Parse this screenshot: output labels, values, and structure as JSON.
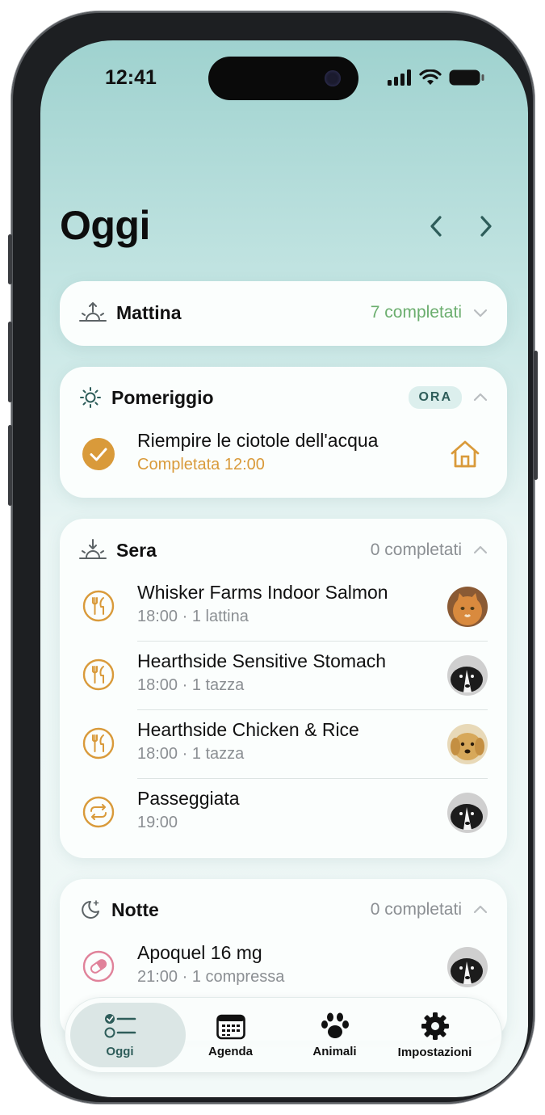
{
  "status_bar": {
    "time": "12:41"
  },
  "header": {
    "title": "Oggi",
    "prev_icon": "chevron-left-icon",
    "next_icon": "chevron-right-icon"
  },
  "colors": {
    "accent": "#D99A3A",
    "teal": "#2E5D5A",
    "completed_green": "#6BAE6E",
    "pill_pink": "#E0829A"
  },
  "sections": {
    "mattina": {
      "title": "Mattina",
      "count": "7 completati",
      "icon": "sunrise-icon"
    },
    "pomeriggio": {
      "title": "Pomeriggio",
      "badge": "ORA",
      "icon": "sun-icon",
      "items": [
        {
          "title": "Riempire le ciotole dell'acqua",
          "subtitle": "Completata 12:00",
          "icon": "check-circle-icon",
          "trailing_icon": "house-icon"
        }
      ]
    },
    "sera": {
      "title": "Sera",
      "count": "0 completati",
      "icon": "sunset-icon",
      "items": [
        {
          "title": "Whisker Farms Indoor Salmon",
          "subtitle": "18:00 · 1 lattina",
          "icon": "fork-knife-icon",
          "avatar": "orange-cat"
        },
        {
          "title": "Hearthside Sensitive Stomach",
          "subtitle": "18:00 · 1 tazza",
          "icon": "fork-knife-icon",
          "avatar": "border-collie"
        },
        {
          "title": "Hearthside Chicken & Rice",
          "subtitle": "18:00 · 1 tazza",
          "icon": "fork-knife-icon",
          "avatar": "golden-retriever"
        },
        {
          "title": "Passeggiata",
          "subtitle": "19:00",
          "icon": "repeat-icon",
          "avatar": "border-collie"
        }
      ]
    },
    "notte": {
      "title": "Notte",
      "count": "0 completati",
      "icon": "moon-stars-icon",
      "items": [
        {
          "title": "Apoquel 16 mg",
          "subtitle": "21:00 · 1 compressa",
          "icon": "pill-icon",
          "avatar": "border-collie"
        }
      ]
    }
  },
  "tabbar": {
    "tabs": [
      {
        "label": "Oggi",
        "icon": "checklist-icon",
        "active": true
      },
      {
        "label": "Agenda",
        "icon": "calendar-icon",
        "active": false
      },
      {
        "label": "Animali",
        "icon": "paw-icon",
        "active": false
      },
      {
        "label": "Impostazioni",
        "icon": "gear-icon",
        "active": false
      }
    ]
  }
}
